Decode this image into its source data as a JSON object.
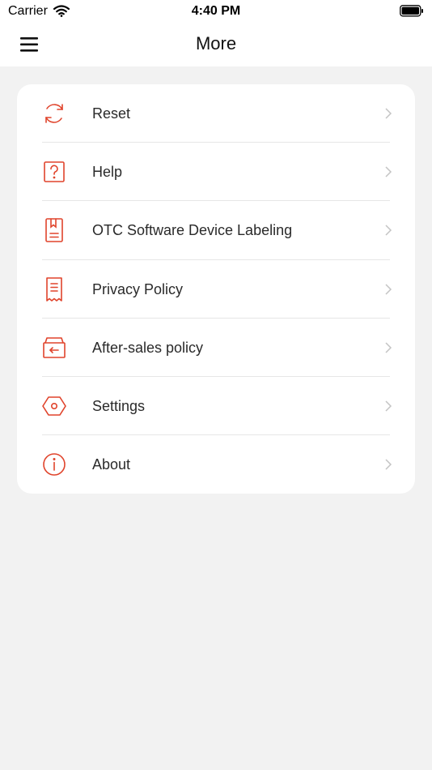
{
  "status_bar": {
    "carrier": "Carrier",
    "time": "4:40 PM"
  },
  "nav": {
    "title": "More",
    "menu_icon": "hamburger-menu-icon"
  },
  "accent_color": "#e0442c",
  "menu": {
    "items": [
      {
        "label": "Reset",
        "icon": "reset-icon"
      },
      {
        "label": "Help",
        "icon": "help-icon"
      },
      {
        "label": "OTC Software Device Labeling",
        "icon": "label-document-icon"
      },
      {
        "label": "Privacy Policy",
        "icon": "receipt-icon"
      },
      {
        "label": "After-sales policy",
        "icon": "return-box-icon"
      },
      {
        "label": "Settings",
        "icon": "hexagon-settings-icon"
      },
      {
        "label": "About",
        "icon": "info-icon"
      }
    ]
  }
}
